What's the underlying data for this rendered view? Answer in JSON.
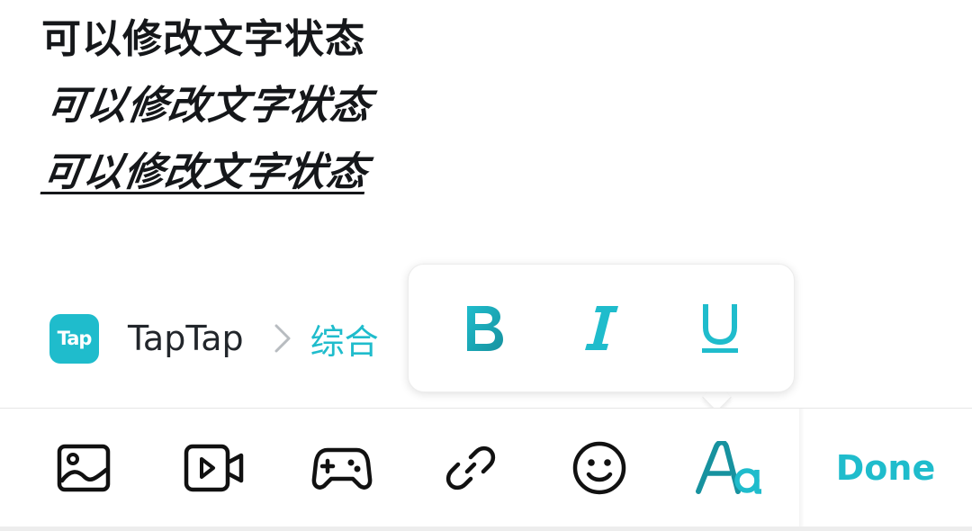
{
  "editor": {
    "lines": [
      "可以修改文字状态",
      "可以修改文字状态",
      "可以修改文字状态"
    ]
  },
  "breadcrumb": {
    "logo_text": "Tap",
    "app": "TapTap",
    "category": "综合"
  },
  "format_popup": {
    "bold_label": "B",
    "italic_label": "I",
    "underline_label": "U"
  },
  "toolbar": {
    "tools": [
      "image-icon",
      "video-icon",
      "gamepad-icon",
      "link-icon",
      "emoji-icon",
      "text-format-icon"
    ],
    "done_label": "Done"
  },
  "colors": {
    "accent": "#1fbccc",
    "accent_dark": "#17929f",
    "text": "#15171a"
  }
}
